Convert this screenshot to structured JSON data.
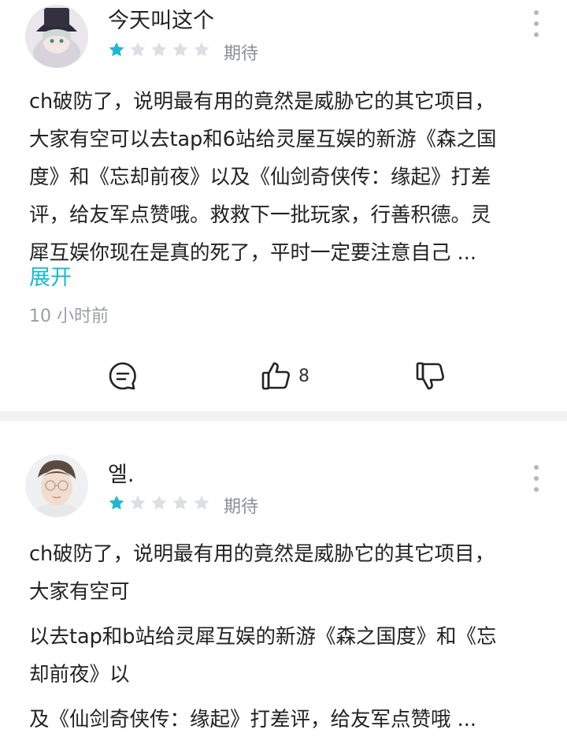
{
  "reviews": [
    {
      "username": "今天叫这个",
      "rating": 1,
      "rating_max": 5,
      "tag": "期待",
      "lines": [
        "ch破防了，说明最有用的竟然是威胁它的其它项目，",
        "大家有空可以去tap和6站给灵屋互娱的新游《森之国",
        "度》和《忘却前夜》以及《仙剑奇侠传：缘起》打差",
        "评，给友军点赞哦。救救下一批玩家，行善积德。灵",
        "犀互娱你现在是真的死了，平时一定要注意自己 ..."
      ],
      "expand_label": "展开",
      "time": "10 小时前",
      "like_count": "8"
    },
    {
      "username": "엘.",
      "rating": 1,
      "rating_max": 5,
      "tag": "期待",
      "paragraphs": [
        [
          "ch破防了，说明最有用的竟然是威胁它的其它项目，",
          "大家有空可"
        ],
        [
          "以去tap和b站给灵犀互娱的新游《森之国度》和《忘",
          "却前夜》以"
        ],
        [
          "及《仙剑奇侠传：缘起》打差评，给友军点赞哦 ..."
        ]
      ]
    }
  ],
  "colors": {
    "accent": "#17b9d1",
    "star_on": "#1fb6d0",
    "star_off": "#dcdfe3",
    "meta": "#9a9ea4"
  },
  "icons": [
    "comment-icon",
    "thumb-up-icon",
    "thumb-down-icon",
    "more-vertical-icon",
    "star-icon"
  ]
}
